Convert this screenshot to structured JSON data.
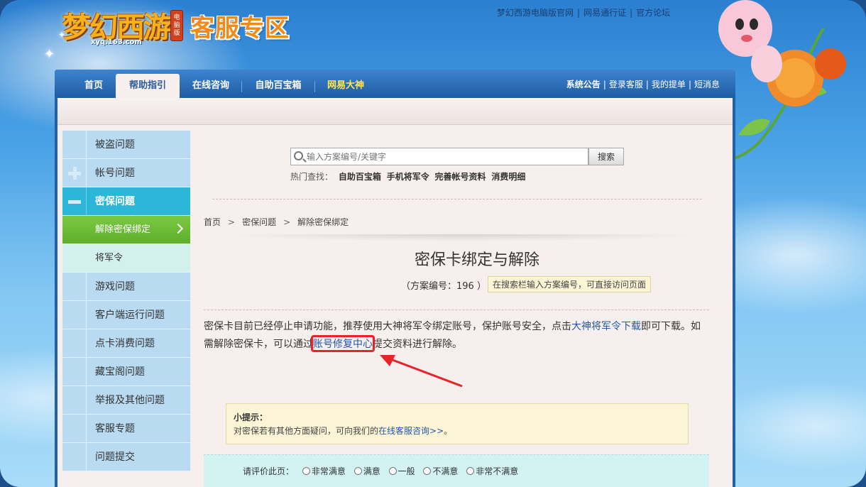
{
  "header": {
    "logo_text": "梦幻西游",
    "logo_badge": "电脑版",
    "logo_domain": "xyq.163.com",
    "site_title": "客服专区",
    "top_links": [
      "梦幻西游电脑版官网",
      "网易通行证",
      "官方论坛"
    ]
  },
  "nav": {
    "items": [
      {
        "label": "首页"
      },
      {
        "label": "帮助指引"
      },
      {
        "label": "在线咨询"
      },
      {
        "label": "自助百宝箱"
      },
      {
        "label": "网易大神"
      }
    ],
    "active_index": 1,
    "right_links": [
      "系统公告",
      "登录客服",
      "我的提单",
      "短消息"
    ]
  },
  "sidebar": {
    "items": [
      {
        "label": "被盗问题"
      },
      {
        "label": "帐号问题"
      },
      {
        "label": "密保问题"
      },
      {
        "label": "游戏问题"
      },
      {
        "label": "客户端运行问题"
      },
      {
        "label": "点卡消费问题"
      },
      {
        "label": "藏宝阁问题"
      },
      {
        "label": "举报及其他问题"
      },
      {
        "label": "客服专题"
      },
      {
        "label": "问题提交"
      }
    ],
    "sub_items": [
      {
        "label": "解除密保绑定"
      },
      {
        "label": "将军令"
      }
    ]
  },
  "search": {
    "placeholder": "输入方案编号/关键字",
    "button": "搜索",
    "hot_label": "热门查找：",
    "hot_links": [
      "自助百宝箱",
      "手机将军令",
      "完善帐号资料",
      "消费明细"
    ]
  },
  "breadcrumb": [
    "首页",
    "密保问题",
    "解除密保绑定"
  ],
  "article": {
    "title": "密保卡绑定与解除",
    "plan_no": "（方案编号：196 ）",
    "plan_tip": "在搜索栏输入方案编号，可直接访问页面",
    "p1_a": "密保卡目前已经停止申请功能，推荐使用大神将军令绑定账号，保护账号安全，点击",
    "p1_link": "大神将军令下载",
    "p1_b": "即可下载。如需解除密保卡，可以通过",
    "p1_link2": "账号修复中心",
    "p1_c": "提交资料进行解除。"
  },
  "tip": {
    "title": "小提示：",
    "text_a": "对密保若有其他方面疑问，可向我们的",
    "link": "在线客服咨询>>",
    "text_b": "。"
  },
  "rating": {
    "label": "请评价此页：",
    "options": [
      "非常满意",
      "满意",
      "一般",
      "不满意",
      "非常不满意"
    ]
  },
  "colors": {
    "accent_blue": "#2361a6",
    "active_green": "#6aba36",
    "open_cyan": "#2cb7d9",
    "highlight_red": "#e8242a"
  }
}
